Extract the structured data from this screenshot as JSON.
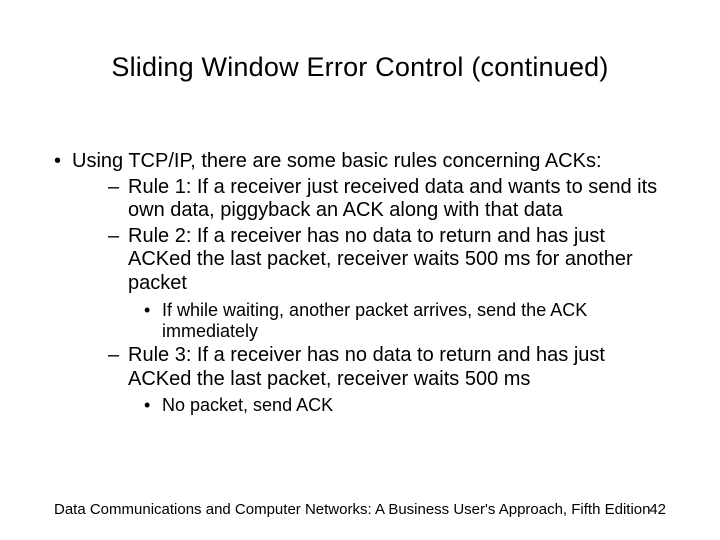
{
  "title": "Sliding Window Error Control (continued)",
  "bullets": {
    "main": "Using TCP/IP, there are some basic rules concerning ACKs:",
    "rule1": "Rule 1: If a receiver just received data and wants to send its own data, piggyback an ACK along with that data",
    "rule2": "Rule 2: If a receiver has no data to return and has just ACKed the last packet, receiver waits 500 ms for another packet",
    "rule2sub": "If while waiting, another packet arrives, send the ACK immediately",
    "rule3": "Rule 3: If a receiver has no data to return and has just ACKed the last packet, receiver waits 500 ms",
    "rule3sub": "No packet, send ACK"
  },
  "footer": {
    "source": "Data Communications and Computer Networks: A Business User's Approach, Fifth Edition",
    "page": "42"
  }
}
